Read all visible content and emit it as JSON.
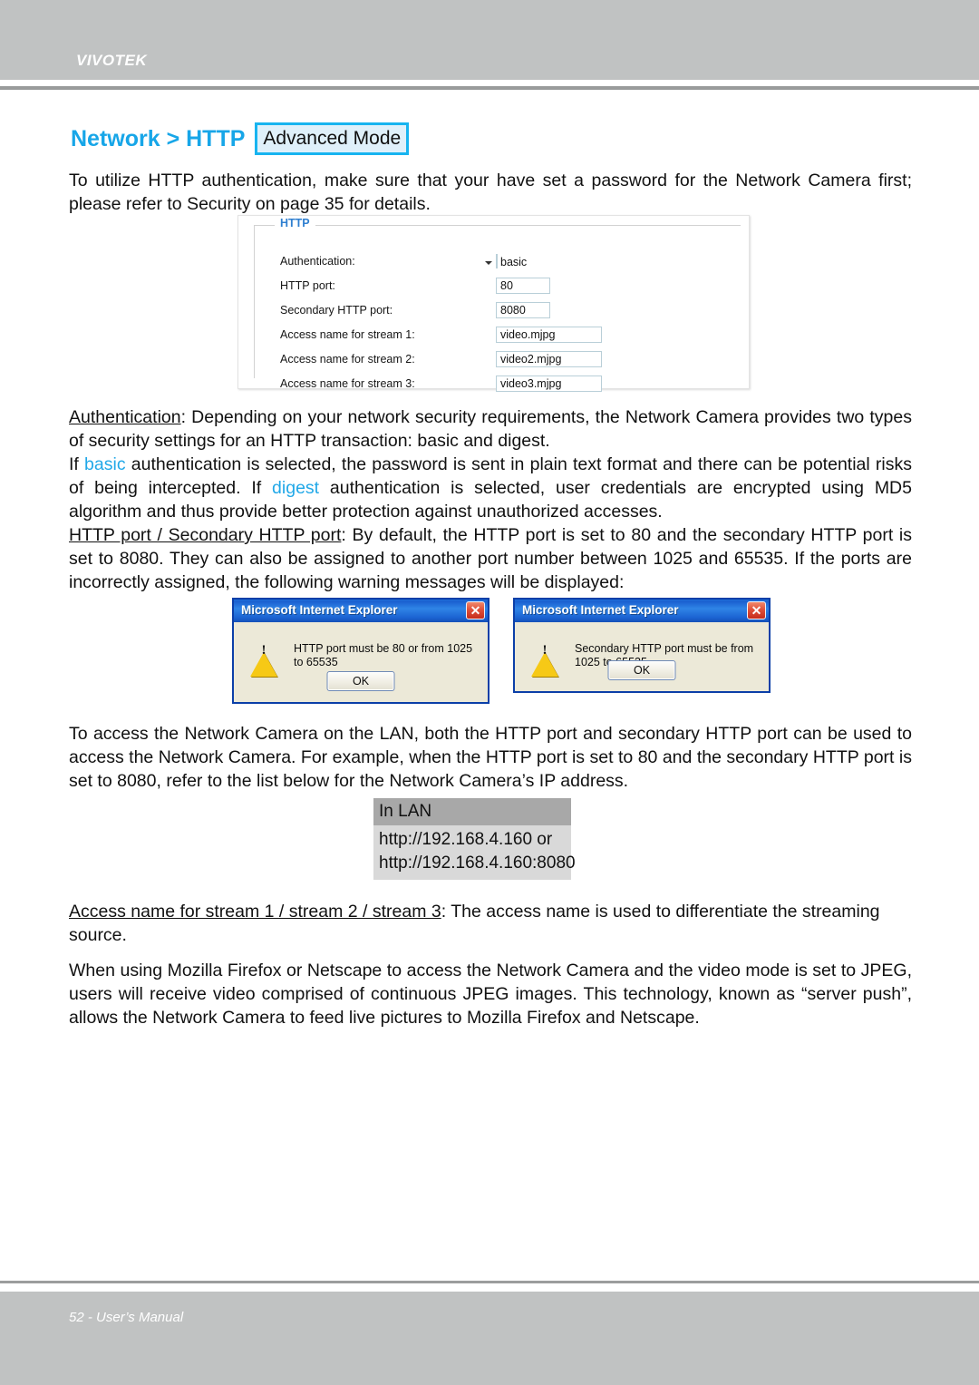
{
  "header": {
    "brand": "VIVOTEK"
  },
  "section": {
    "title": "Network > HTTP",
    "badge": "Advanced Mode",
    "title_color": "#17a6e8",
    "badge_border_color": "#17b4f0",
    "badge_fill_color": "#dff0fa"
  },
  "intro_paragraph": "To utilize HTTP authentication, make sure that your have set a password for the Network Camera first; please refer to Security on page 35 for details.",
  "http_panel": {
    "legend": "HTTP",
    "legend_color": "#2f7fd0",
    "rows": [
      {
        "label": "Authentication:",
        "type": "select",
        "value": "basic"
      },
      {
        "label": "HTTP port:",
        "type": "text-short",
        "value": "80"
      },
      {
        "label": "Secondary HTTP port:",
        "type": "text-short",
        "value": "8080"
      },
      {
        "label": "Access name for stream 1:",
        "type": "text-wide",
        "value": "video.mjpg"
      },
      {
        "label": "Access name for stream 2:",
        "type": "text-wide",
        "value": "video2.mjpg"
      },
      {
        "label": "Access name for stream 3:",
        "type": "text-wide",
        "value": "video3.mjpg"
      }
    ]
  },
  "authentication_paragraph": {
    "term": "Authentication",
    "part1": ": Depending on your network security requirements, the Network Camera provides two types of security settings for an HTTP transaction: basic and digest.",
    "line2_pre": "If ",
    "highlight1": "basic",
    "part2": " authentication is selected, the password is sent in plain text format and there can be potential risks of being intercepted. If ",
    "highlight2": "digest",
    "part3": " authentication is selected, user credentials are encrypted using MD5 algorithm and thus provide better protection against unauthorized accesses.",
    "highlight_color": "#21a8e8"
  },
  "port_paragraph": {
    "term": "HTTP port / Secondary HTTP port",
    "text": ": By default, the HTTP port is set to 80 and the secondary HTTP port is set to 8080. They can also be assigned to another port number between 1025 and 65535. If the ports are incorrectly assigned, the following warning messages will be displayed:"
  },
  "dialogs": [
    {
      "title": "Microsoft Internet Explorer",
      "message": "HTTP port must be 80 or from 1025 to 65535",
      "ok_label": "OK",
      "close_glyph": "✕"
    },
    {
      "title": "Microsoft Internet Explorer",
      "message": "Secondary HTTP port must be from 1025 to 65535",
      "ok_label": "OK",
      "close_glyph": "✕"
    }
  ],
  "lan_paragraph": "To access the Network Camera on the LAN, both the HTTP port and secondary HTTP port can be used to access the Network Camera. For example, when the HTTP port is set to 80 and the secondary HTTP port is set to 8080, refer to the list below for the Network Camera’s IP address.",
  "lan_table": {
    "header": "In LAN",
    "line1": "http://192.168.4.160  or",
    "line2": "http://192.168.4.160:8080"
  },
  "access_name_paragraph": {
    "term": "Access name for stream 1 / stream 2 / stream 3",
    "text": ": The access name is used to differentiate the streaming source."
  },
  "closing_paragraph": "When using Mozilla Firefox or Netscape to access the Network Camera and the video mode is set to JPEG, users will receive video comprised of continuous JPEG images. This technology, known as “server push”, allows the Network Camera to feed live pictures to Mozilla Firefox and Netscape.",
  "footer": {
    "text": "52 - User’s Manual"
  }
}
